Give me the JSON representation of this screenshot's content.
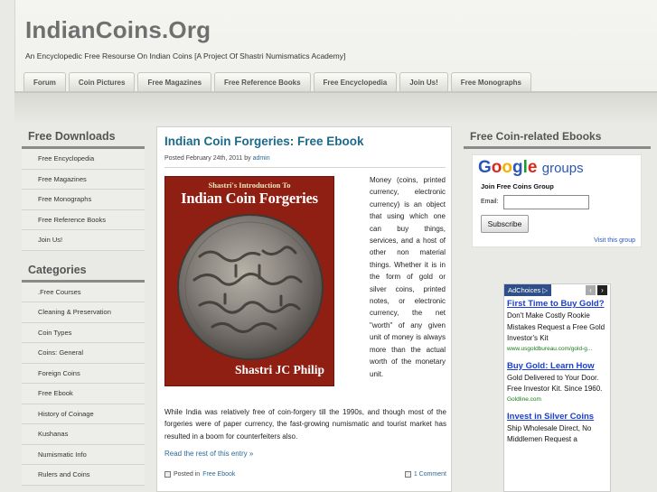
{
  "site": {
    "title": "IndianCoins.Org",
    "tagline": "An Encyclopedic Free Resourse On Indian Coins [A Project Of Shastri Numismatics Academy]"
  },
  "nav": {
    "tabs": [
      {
        "label": "Forum"
      },
      {
        "label": "Coin Pictures"
      },
      {
        "label": "Free Magazines"
      },
      {
        "label": "Free Reference Books"
      },
      {
        "label": "Free Encyclopedia"
      },
      {
        "label": "Join Us!"
      },
      {
        "label": "Free Monographs"
      }
    ]
  },
  "left_sidebar": {
    "downloads_title": "Free Downloads",
    "downloads": [
      {
        "label": "Free Encyclopedia"
      },
      {
        "label": "Free Magazines"
      },
      {
        "label": "Free Monographs"
      },
      {
        "label": "Free Reference Books"
      },
      {
        "label": "Join Us!"
      }
    ],
    "categories_title": "Categories",
    "categories": [
      {
        "label": ".Free Courses"
      },
      {
        "label": "Cleaning & Preservation"
      },
      {
        "label": "Coin Types"
      },
      {
        "label": "Coins: General"
      },
      {
        "label": "Foreign Coins"
      },
      {
        "label": "Free Ebook"
      },
      {
        "label": "History of Coinage"
      },
      {
        "label": "Kushanas"
      },
      {
        "label": "Numismatic Info"
      },
      {
        "label": "Rulers and Coins"
      }
    ]
  },
  "post": {
    "title": "Indian Coin Forgeries: Free Ebook",
    "meta_prefix": "Posted February 24th, 2011 by",
    "author": "admin",
    "cover": {
      "top_line": "Shastri's Introduction To",
      "title": "Indian Coin Forgeries",
      "author": "Shastri JC Philip"
    },
    "side_text": "Money (coins, printed currency, electronic currency) is an object that using which one can buy things, services, and a host of other non material things. Whether it is in the form of gold or silver coins, printed notes, or electronic currency, the net \"worth\" of any given unit of money is always more than the actual worth of the monetary unit.",
    "body_text": "While India was relatively free of coin-forgery till the 1990s, and though most of the forgeries were of paper currency, the fast-growing numismatic and tourist market has resulted in a boom for counterfeiters also.",
    "read_more": "Read the rest of this entry »",
    "posted_in_label": "Posted in",
    "category": "Free Ebook",
    "comments": "1 Comment"
  },
  "right_sidebar": {
    "title": "Free Coin-related Ebooks",
    "google_groups": {
      "logo_letters": [
        {
          "ch": "G",
          "color": "#2a56b8"
        },
        {
          "ch": "o",
          "color": "#d62b1c"
        },
        {
          "ch": "o",
          "color": "#f0b400"
        },
        {
          "ch": "g",
          "color": "#2a56b8"
        },
        {
          "ch": "l",
          "color": "#1d9a35"
        },
        {
          "ch": "e",
          "color": "#d62b1c"
        }
      ],
      "logo_suffix": "groups",
      "join_label": "Join Free Coins Group",
      "email_label": "Email:",
      "email_value": "",
      "subscribe_label": "Subscribe",
      "visit_label": "Visit this group"
    }
  },
  "ad": {
    "choices_label": "AdChoices ▷",
    "prev_icon": "‹",
    "next_icon": "›",
    "items": [
      {
        "headline": "First Time to Buy Gold?",
        "text": "Don't Make Costly Rookie Mistakes Request a Free Gold Investor's Kit",
        "url": "www.usgoldbureau.com/gold-g..."
      },
      {
        "headline": "Buy Gold: Learn How",
        "text": "Gold Delivered to Your Door. Free Investor Kit. Since 1960.",
        "url": "Goldline.com"
      },
      {
        "headline": "Invest in Silver Coins",
        "text": "Ship Wholesale Direct, No Middlemen Request a",
        "url": ""
      }
    ]
  }
}
